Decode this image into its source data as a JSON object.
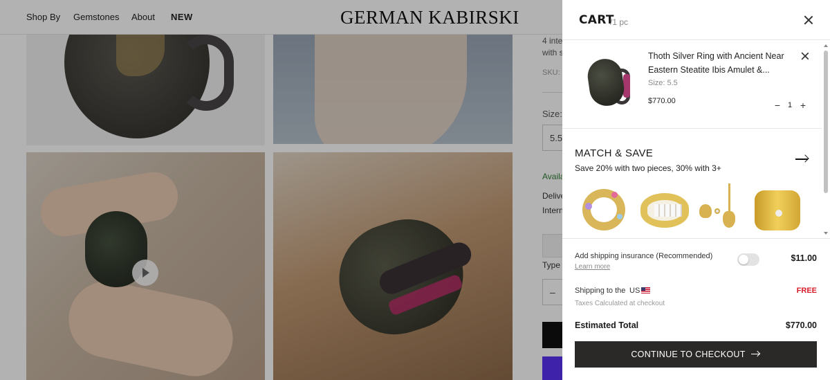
{
  "nav": {
    "items": [
      "Shop By",
      "Gemstones",
      "About",
      "NEW"
    ],
    "logo": "GERMAN KABIRSKI"
  },
  "pdp": {
    "text_line1": "4 inte",
    "text_line2": "with s",
    "sku_label": "SKU:",
    "size_label": "Size:",
    "size_value": "5.5",
    "availability": "Availa",
    "delivery": "Delive",
    "international": "Intern",
    "type_label": "Type",
    "qty_minus": "–"
  },
  "cart": {
    "title": "CART",
    "count": "/1 pc",
    "item": {
      "title": "Thoth Silver Ring with Ancient Near Eastern Steatite Ibis Amulet &...",
      "size": "Size: 5.5",
      "price": "$770.00",
      "qty": "1",
      "minus": "−",
      "plus": "+"
    },
    "match": {
      "title": "MATCH & SAVE",
      "subtitle": "Save 20% with two pieces, 30% with 3+"
    },
    "insurance": {
      "label": "Add shipping insurance (Recommended)",
      "link": "Learn more",
      "price": "$11.00",
      "enabled": false
    },
    "shipping": {
      "label": "Shipping to the",
      "country": "US",
      "value": "FREE",
      "taxes": "Taxes Calculated at checkout"
    },
    "total": {
      "label": "Estimated Total",
      "value": "$770.00"
    },
    "checkout_label": "CONTINUE TO CHECKOUT"
  },
  "colors": {
    "accent_dark": "#2b2828",
    "free_red": "#d81b2a",
    "overlay": "rgba(0,0,0,0.3)"
  }
}
